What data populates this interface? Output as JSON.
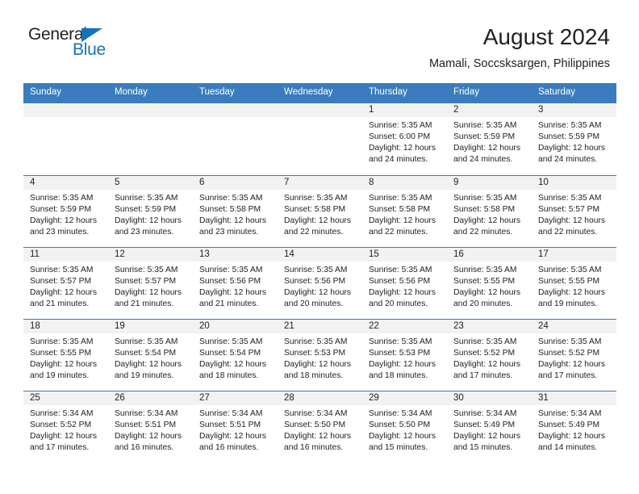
{
  "logo": {
    "word_top": "General",
    "word_bottom": "Blue",
    "triangle": "blue-triangle-icon",
    "color_dark": "#231f20",
    "color_blue": "#1274bc"
  },
  "header": {
    "title": "August 2024",
    "subtitle": "Mamali, Soccsksargen, Philippines"
  },
  "theme": {
    "header_blue": "#3a7cbd",
    "day_band_gray": "#f2f2f2",
    "text": "#222222"
  },
  "weekdays": [
    "Sunday",
    "Monday",
    "Tuesday",
    "Wednesday",
    "Thursday",
    "Friday",
    "Saturday"
  ],
  "weeks": [
    [
      {
        "day": "",
        "lines": []
      },
      {
        "day": "",
        "lines": []
      },
      {
        "day": "",
        "lines": []
      },
      {
        "day": "",
        "lines": []
      },
      {
        "day": "1",
        "lines": [
          "Sunrise: 5:35 AM",
          "Sunset: 6:00 PM",
          "Daylight: 12 hours",
          "and 24 minutes."
        ]
      },
      {
        "day": "2",
        "lines": [
          "Sunrise: 5:35 AM",
          "Sunset: 5:59 PM",
          "Daylight: 12 hours",
          "and 24 minutes."
        ]
      },
      {
        "day": "3",
        "lines": [
          "Sunrise: 5:35 AM",
          "Sunset: 5:59 PM",
          "Daylight: 12 hours",
          "and 24 minutes."
        ]
      }
    ],
    [
      {
        "day": "4",
        "lines": [
          "Sunrise: 5:35 AM",
          "Sunset: 5:59 PM",
          "Daylight: 12 hours",
          "and 23 minutes."
        ]
      },
      {
        "day": "5",
        "lines": [
          "Sunrise: 5:35 AM",
          "Sunset: 5:59 PM",
          "Daylight: 12 hours",
          "and 23 minutes."
        ]
      },
      {
        "day": "6",
        "lines": [
          "Sunrise: 5:35 AM",
          "Sunset: 5:58 PM",
          "Daylight: 12 hours",
          "and 23 minutes."
        ]
      },
      {
        "day": "7",
        "lines": [
          "Sunrise: 5:35 AM",
          "Sunset: 5:58 PM",
          "Daylight: 12 hours",
          "and 22 minutes."
        ]
      },
      {
        "day": "8",
        "lines": [
          "Sunrise: 5:35 AM",
          "Sunset: 5:58 PM",
          "Daylight: 12 hours",
          "and 22 minutes."
        ]
      },
      {
        "day": "9",
        "lines": [
          "Sunrise: 5:35 AM",
          "Sunset: 5:58 PM",
          "Daylight: 12 hours",
          "and 22 minutes."
        ]
      },
      {
        "day": "10",
        "lines": [
          "Sunrise: 5:35 AM",
          "Sunset: 5:57 PM",
          "Daylight: 12 hours",
          "and 22 minutes."
        ]
      }
    ],
    [
      {
        "day": "11",
        "lines": [
          "Sunrise: 5:35 AM",
          "Sunset: 5:57 PM",
          "Daylight: 12 hours",
          "and 21 minutes."
        ]
      },
      {
        "day": "12",
        "lines": [
          "Sunrise: 5:35 AM",
          "Sunset: 5:57 PM",
          "Daylight: 12 hours",
          "and 21 minutes."
        ]
      },
      {
        "day": "13",
        "lines": [
          "Sunrise: 5:35 AM",
          "Sunset: 5:56 PM",
          "Daylight: 12 hours",
          "and 21 minutes."
        ]
      },
      {
        "day": "14",
        "lines": [
          "Sunrise: 5:35 AM",
          "Sunset: 5:56 PM",
          "Daylight: 12 hours",
          "and 20 minutes."
        ]
      },
      {
        "day": "15",
        "lines": [
          "Sunrise: 5:35 AM",
          "Sunset: 5:56 PM",
          "Daylight: 12 hours",
          "and 20 minutes."
        ]
      },
      {
        "day": "16",
        "lines": [
          "Sunrise: 5:35 AM",
          "Sunset: 5:55 PM",
          "Daylight: 12 hours",
          "and 20 minutes."
        ]
      },
      {
        "day": "17",
        "lines": [
          "Sunrise: 5:35 AM",
          "Sunset: 5:55 PM",
          "Daylight: 12 hours",
          "and 19 minutes."
        ]
      }
    ],
    [
      {
        "day": "18",
        "lines": [
          "Sunrise: 5:35 AM",
          "Sunset: 5:55 PM",
          "Daylight: 12 hours",
          "and 19 minutes."
        ]
      },
      {
        "day": "19",
        "lines": [
          "Sunrise: 5:35 AM",
          "Sunset: 5:54 PM",
          "Daylight: 12 hours",
          "and 19 minutes."
        ]
      },
      {
        "day": "20",
        "lines": [
          "Sunrise: 5:35 AM",
          "Sunset: 5:54 PM",
          "Daylight: 12 hours",
          "and 18 minutes."
        ]
      },
      {
        "day": "21",
        "lines": [
          "Sunrise: 5:35 AM",
          "Sunset: 5:53 PM",
          "Daylight: 12 hours",
          "and 18 minutes."
        ]
      },
      {
        "day": "22",
        "lines": [
          "Sunrise: 5:35 AM",
          "Sunset: 5:53 PM",
          "Daylight: 12 hours",
          "and 18 minutes."
        ]
      },
      {
        "day": "23",
        "lines": [
          "Sunrise: 5:35 AM",
          "Sunset: 5:52 PM",
          "Daylight: 12 hours",
          "and 17 minutes."
        ]
      },
      {
        "day": "24",
        "lines": [
          "Sunrise: 5:35 AM",
          "Sunset: 5:52 PM",
          "Daylight: 12 hours",
          "and 17 minutes."
        ]
      }
    ],
    [
      {
        "day": "25",
        "lines": [
          "Sunrise: 5:34 AM",
          "Sunset: 5:52 PM",
          "Daylight: 12 hours",
          "and 17 minutes."
        ]
      },
      {
        "day": "26",
        "lines": [
          "Sunrise: 5:34 AM",
          "Sunset: 5:51 PM",
          "Daylight: 12 hours",
          "and 16 minutes."
        ]
      },
      {
        "day": "27",
        "lines": [
          "Sunrise: 5:34 AM",
          "Sunset: 5:51 PM",
          "Daylight: 12 hours",
          "and 16 minutes."
        ]
      },
      {
        "day": "28",
        "lines": [
          "Sunrise: 5:34 AM",
          "Sunset: 5:50 PM",
          "Daylight: 12 hours",
          "and 16 minutes."
        ]
      },
      {
        "day": "29",
        "lines": [
          "Sunrise: 5:34 AM",
          "Sunset: 5:50 PM",
          "Daylight: 12 hours",
          "and 15 minutes."
        ]
      },
      {
        "day": "30",
        "lines": [
          "Sunrise: 5:34 AM",
          "Sunset: 5:49 PM",
          "Daylight: 12 hours",
          "and 15 minutes."
        ]
      },
      {
        "day": "31",
        "lines": [
          "Sunrise: 5:34 AM",
          "Sunset: 5:49 PM",
          "Daylight: 12 hours",
          "and 14 minutes."
        ]
      }
    ]
  ]
}
